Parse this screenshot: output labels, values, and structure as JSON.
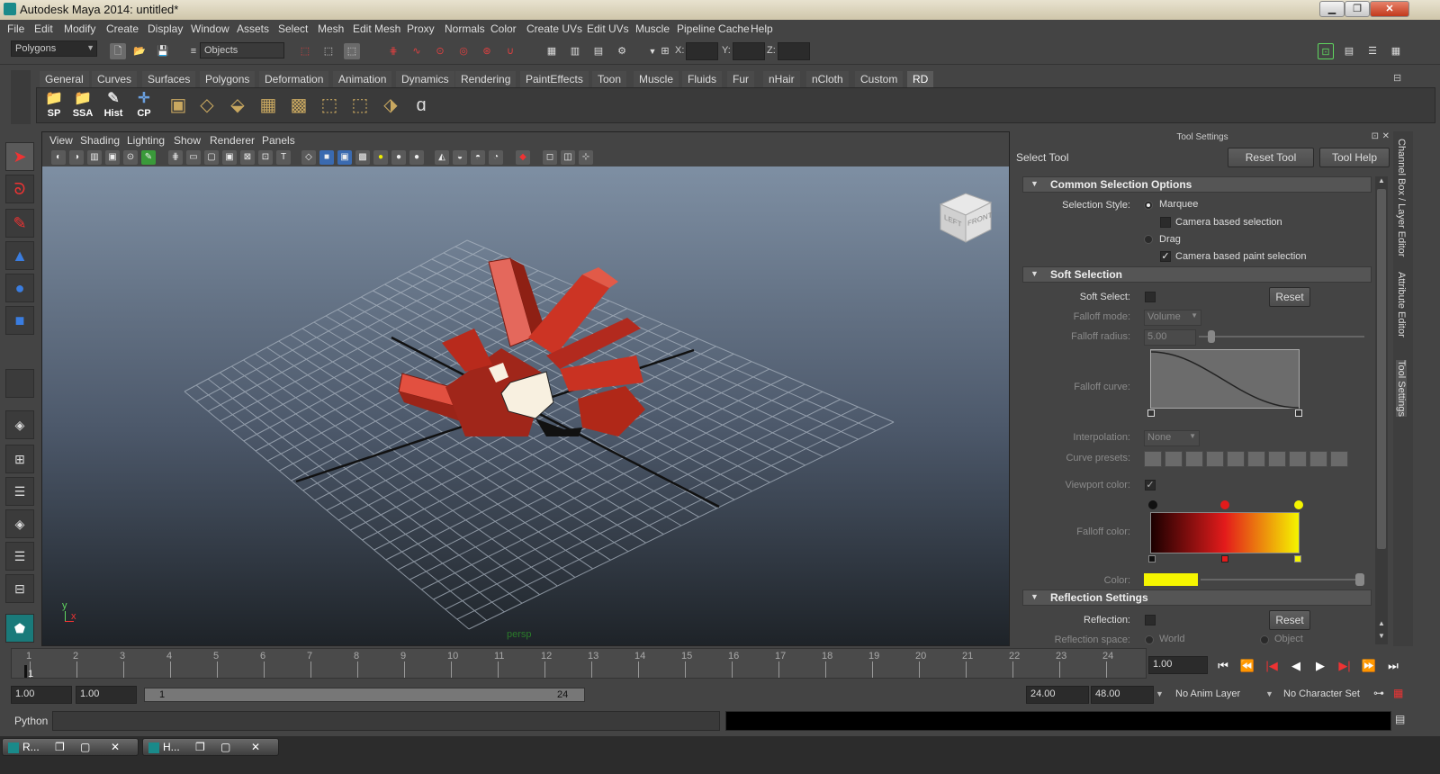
{
  "window": {
    "title": "Autodesk Maya 2014: untitled*",
    "min": "▁",
    "restore": "❐",
    "close": "✕"
  },
  "menu": [
    "File",
    "Edit",
    "Modify",
    "Create",
    "Display",
    "Window",
    "Assets",
    "Select",
    "Mesh",
    "Edit Mesh",
    "Proxy",
    "Normals",
    "Color",
    "Create UVs",
    "Edit UVs",
    "Muscle",
    "Pipeline Cache",
    "Help"
  ],
  "toolbar": {
    "mode": "Polygons",
    "selection_mask": "Objects",
    "x_label": "X:",
    "y_label": "Y:",
    "z_label": "Z:"
  },
  "shelf_tabs": [
    "General",
    "Curves",
    "Surfaces",
    "Polygons",
    "Deformation",
    "Animation",
    "Dynamics",
    "Rendering",
    "PaintEffects",
    "Toon",
    "Muscle",
    "Fluids",
    "Fur",
    "nHair",
    "nCloth",
    "Custom",
    "RD"
  ],
  "shelf_active_tab": "RD",
  "shelf_buttons": [
    "SP",
    "SSA",
    "Hist",
    "CP"
  ],
  "viewport": {
    "menu": [
      "View",
      "Shading",
      "Lighting",
      "Show",
      "Renderer",
      "Panels"
    ],
    "camera_label": "persp",
    "viewcube": {
      "left": "LEFT",
      "front": "FRONT"
    },
    "axis": {
      "y": "y",
      "x": "x"
    }
  },
  "tool_settings": {
    "panel_title": "Tool Settings",
    "tool_name": "Select Tool",
    "reset_tool": "Reset Tool",
    "tool_help": "Tool Help",
    "common": {
      "header": "Common Selection Options",
      "style_label": "Selection Style:",
      "marquee": "Marquee",
      "camera_based": "Camera based selection",
      "drag": "Drag",
      "camera_paint": "Camera based paint selection"
    },
    "soft": {
      "header": "Soft Selection",
      "soft_select": "Soft Select:",
      "reset": "Reset",
      "falloff_mode": "Falloff mode:",
      "falloff_mode_value": "Volume",
      "falloff_radius": "Falloff radius:",
      "falloff_radius_value": "5.00",
      "falloff_curve": "Falloff curve:",
      "interpolation": "Interpolation:",
      "interpolation_value": "None",
      "curve_presets": "Curve presets:",
      "viewport_color": "Viewport color:",
      "falloff_color": "Falloff color:",
      "color": "Color:",
      "color_swatch": "#f5f500"
    },
    "reflection": {
      "header": "Reflection Settings",
      "reflection": "Reflection:",
      "reset": "Reset",
      "space": "Reflection space:",
      "world": "World",
      "object": "Object"
    }
  },
  "side_tabs": [
    "Channel Box / Layer Editor",
    "Attribute Editor",
    "Tool Settings"
  ],
  "timeline": {
    "ticks": [
      "1",
      "2",
      "3",
      "4",
      "5",
      "6",
      "7",
      "8",
      "9",
      "10",
      "11",
      "12",
      "13",
      "14",
      "15",
      "16",
      "17",
      "18",
      "19",
      "20",
      "21",
      "22",
      "23",
      "24"
    ],
    "current": "1",
    "current_field": "1.00"
  },
  "playback": [
    "⏮",
    "⏪",
    "|◀",
    "◀",
    "▶",
    "▶|",
    "⏩",
    "⏭"
  ],
  "range": {
    "start": "1.00",
    "start2": "1.00",
    "slider_start": "1",
    "slider_end": "24",
    "end": "24.00",
    "end2": "48.00",
    "anim_layer": "No Anim Layer",
    "char_set": "No Character Set"
  },
  "command": {
    "lang": "Python"
  },
  "taskbar": [
    {
      "label": "R..."
    },
    {
      "label": "H..."
    }
  ]
}
